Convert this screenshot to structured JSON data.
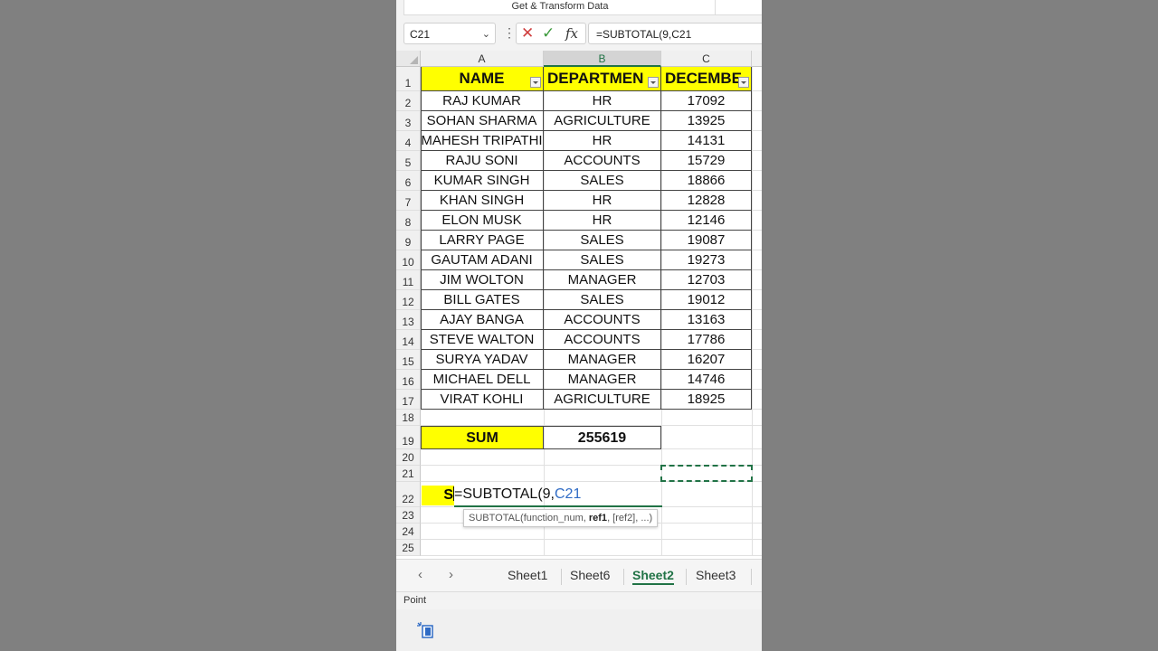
{
  "ribbon": {
    "group_label": "Get & Transform Data"
  },
  "formula_bar": {
    "name_box": "C21",
    "formula": "=SUBTOTAL(9,C21"
  },
  "columns": [
    {
      "letter": "A",
      "selected": false
    },
    {
      "letter": "B",
      "selected": true
    },
    {
      "letter": "C",
      "selected": false
    }
  ],
  "row_numbers": [
    "1",
    "2",
    "3",
    "4",
    "5",
    "6",
    "7",
    "8",
    "9",
    "10",
    "11",
    "12",
    "13",
    "14",
    "15",
    "16",
    "17",
    "18",
    "19",
    "20",
    "21",
    "22",
    "23",
    "24",
    "25"
  ],
  "table": {
    "headers": [
      "NAME",
      "DEPARTMEN",
      "DECEMBE"
    ],
    "rows": [
      [
        "RAJ KUMAR",
        "HR",
        "17092"
      ],
      [
        "SOHAN SHARMA",
        "AGRICULTURE",
        "13925"
      ],
      [
        "MAHESH TRIPATHI",
        "HR",
        "14131"
      ],
      [
        "RAJU SONI",
        "ACCOUNTS",
        "15729"
      ],
      [
        "KUMAR SINGH",
        "SALES",
        "18866"
      ],
      [
        "KHAN SINGH",
        "HR",
        "12828"
      ],
      [
        "ELON MUSK",
        "HR",
        "12146"
      ],
      [
        "LARRY PAGE",
        "SALES",
        "19087"
      ],
      [
        "GAUTAM ADANI",
        "SALES",
        "19273"
      ],
      [
        "JIM WOLTON",
        "MANAGER",
        "12703"
      ],
      [
        "BILL GATES",
        "SALES",
        "19012"
      ],
      [
        "AJAY BANGA",
        "ACCOUNTS",
        "13163"
      ],
      [
        "STEVE WALTON",
        "ACCOUNTS",
        "17786"
      ],
      [
        "SURYA YADAV",
        "MANAGER",
        "16207"
      ],
      [
        "MICHAEL DELL",
        "MANAGER",
        "14746"
      ],
      [
        "VIRAT KOHLI",
        "AGRICULTURE",
        "18925"
      ]
    ]
  },
  "sum_row": {
    "label": "SUM",
    "value": "255619"
  },
  "edit_cell": {
    "prefix": "S",
    "formula_main": "=SUBTOTAL(9,",
    "formula_ref": "C21"
  },
  "tooltip": {
    "fn": "SUBTOTAL(function_num, ",
    "bold_arg": "ref1",
    "rest": ", [ref2], ...)"
  },
  "sheet_tabs": [
    {
      "label": "Sheet1",
      "active": false
    },
    {
      "label": "Sheet6",
      "active": false
    },
    {
      "label": "Sheet2",
      "active": true
    },
    {
      "label": "Sheet3",
      "active": false
    }
  ],
  "status_bar": {
    "mode": "Point"
  },
  "colors": {
    "accent": "#217346",
    "highlight": "#ffff00",
    "reference": "#2f6bc5"
  }
}
